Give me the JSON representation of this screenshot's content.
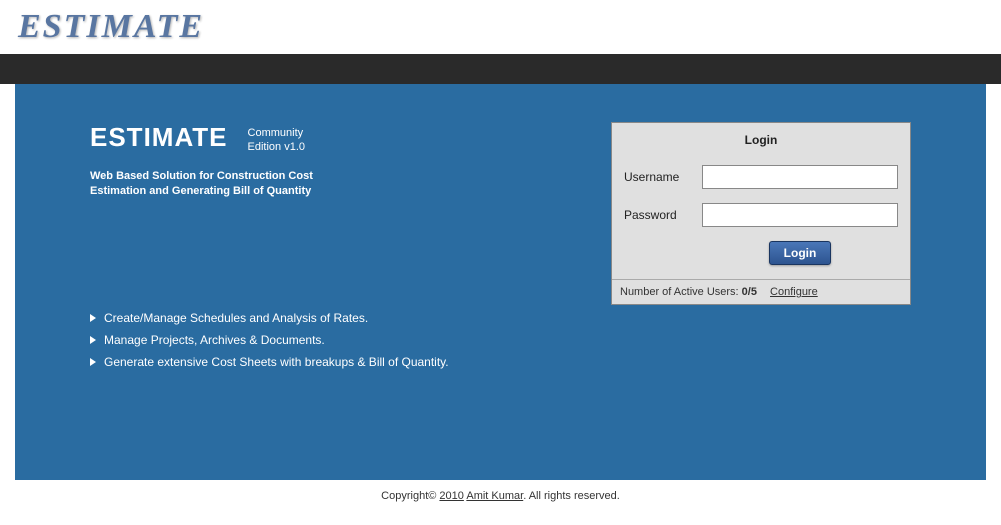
{
  "header": {
    "logo": "ESTIMATE"
  },
  "hero": {
    "title": "ESTIMATE",
    "edition_line1": "Community",
    "edition_line2": "Edition v1.0",
    "tagline_line1": "Web Based Solution for Construction Cost",
    "tagline_line2": "Estimation and Generating Bill of Quantity"
  },
  "features": [
    "Create/Manage Schedules and Analysis of Rates.",
    "Manage Projects, Archives & Documents.",
    "Generate extensive Cost Sheets with breakups & Bill of Quantity."
  ],
  "login": {
    "title": "Login",
    "username_label": "Username",
    "password_label": "Password",
    "username_value": "",
    "password_value": "",
    "button": "Login",
    "active_users_label": "Number of Active Users: ",
    "active_users_count": "0/5",
    "configure": "Configure"
  },
  "footer": {
    "copyright_prefix": "Copyright© ",
    "year": "2010",
    "author": "Amit Kumar",
    "suffix": ". All rights reserved."
  }
}
